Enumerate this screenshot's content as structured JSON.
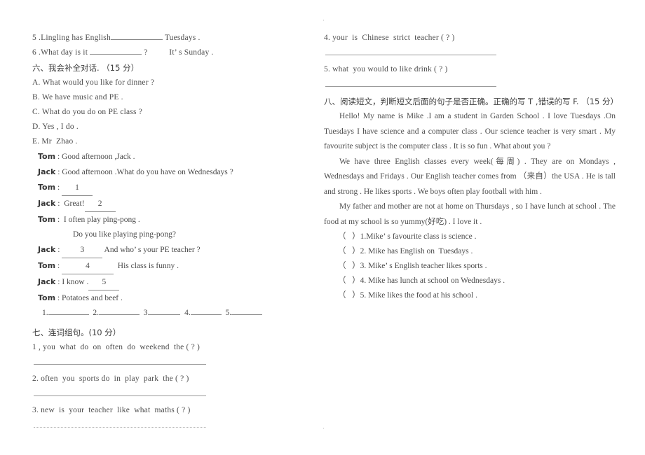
{
  "page": {
    "top_mark": "·",
    "bottom_mark": "·"
  },
  "left_column": {
    "carryover_items": [
      "5 .Lingling has English ",
      " Tuesdays .",
      "6 .What day is it ",
      " ?          It’ s Sunday ."
    ],
    "item5_prefix": "5 .Lingling has English",
    "item5_suffix": "Tuesdays .",
    "item6_prefix": "6 .What day is it",
    "item6_suffix": "?          It’ s Sunday .",
    "section6": {
      "heading": "六、我会补全对话. （15 分）",
      "options": [
        "A. What would you like for dinner ?",
        "B. We have music and PE .",
        "C. What do you do on PE class ?",
        "D. Yes , I do .",
        "E. Mr  Zhao ."
      ],
      "dialogue": [
        {
          "speaker": "Tom",
          "sep": " : ",
          "text": "Good afternoon ,Jack .",
          "blank": "",
          "after": ""
        },
        {
          "speaker": "Jack",
          "sep": " : ",
          "text": "Good afternoon .What do you have on Wednesdays ?",
          "blank": "",
          "after": ""
        },
        {
          "speaker": "Tom",
          "sep": " : ",
          "text": "",
          "blank": "1",
          "after": ""
        },
        {
          "speaker": "Jack",
          "sep": " : ",
          "text": " Great!",
          "blank": "2",
          "after": ""
        },
        {
          "speaker": "Tom",
          "sep": " : ",
          "text": " I often play ping-pong .",
          "blank": "",
          "after": ""
        },
        {
          "speaker": "",
          "sep": "",
          "text": "Do you like playing ping-pong?",
          "blank": "",
          "after": "",
          "continuation": true
        },
        {
          "speaker": "Jack",
          "sep": " : ",
          "text": "",
          "blank": "3",
          "after": " And who’ s your PE teacher ?"
        },
        {
          "speaker": "Tom",
          "sep": " : ",
          "text": "",
          "blank": "4",
          "after": "  His class is funny ."
        },
        {
          "speaker": "Jack",
          "sep": " : ",
          "text": "I know .",
          "blank": "5",
          "after": ""
        },
        {
          "speaker": "Tom",
          "sep": " : ",
          "text": "Potatoes and beef .",
          "blank": "",
          "after": ""
        }
      ],
      "answer_numbers": [
        "1.",
        "2.",
        "3.",
        "4.",
        "5."
      ]
    },
    "section7": {
      "heading": "七、连词组句。(10 分）",
      "items": [
        "1 , you  what  do  on  often  do  weekend  the ( ? )",
        "2. often  you  sports do  in  play  park  the ( ? )",
        "3. new  is  your  teacher  like  what  maths ( ? )"
      ]
    }
  },
  "right_column": {
    "section7_continued": {
      "items": [
        "4. your  is  Chinese  strict  teacher ( ? )",
        "5. what  you would to like drink ( ? )"
      ]
    },
    "section8": {
      "heading": "八、阅读短文，判断短文后面的句子是否正确。正确的写 T ,错误的写 F. （15 分）",
      "passage": [
        "Hello! My name is Mike .I am a student in Garden School . I love Tuesdays .On Tuesdays I have science and a computer class . Our science teacher is very smart . My favourite subject is the computer class . It is so fun . What about you ?",
        "We have three English classes every week(每周) . They are on Mondays , Wednesdays and Fridays . Our English teacher comes from （来自）the USA . He is tall and strong . He likes sports . We boys often play football with him .",
        "My father and mother are not at home on Thursdays , so I have lunch at school . The food at my school is so yummy(好吃) . I love it ."
      ],
      "tf_items": [
        {
          "mark": "（   ）",
          "text": "1.Mike’ s favourite class is science ."
        },
        {
          "mark": "（   ）",
          "text": "2. Mike has English on  Tuesdays ."
        },
        {
          "mark": "（   ）",
          "text": "3. Mike’ s English teacher likes sports ."
        },
        {
          "mark": "（   ）",
          "text": "4. Mike has lunch at school on Wednesdays ."
        },
        {
          "mark": "（   ）",
          "text": "5. Mike likes the food at his school ."
        }
      ]
    }
  }
}
